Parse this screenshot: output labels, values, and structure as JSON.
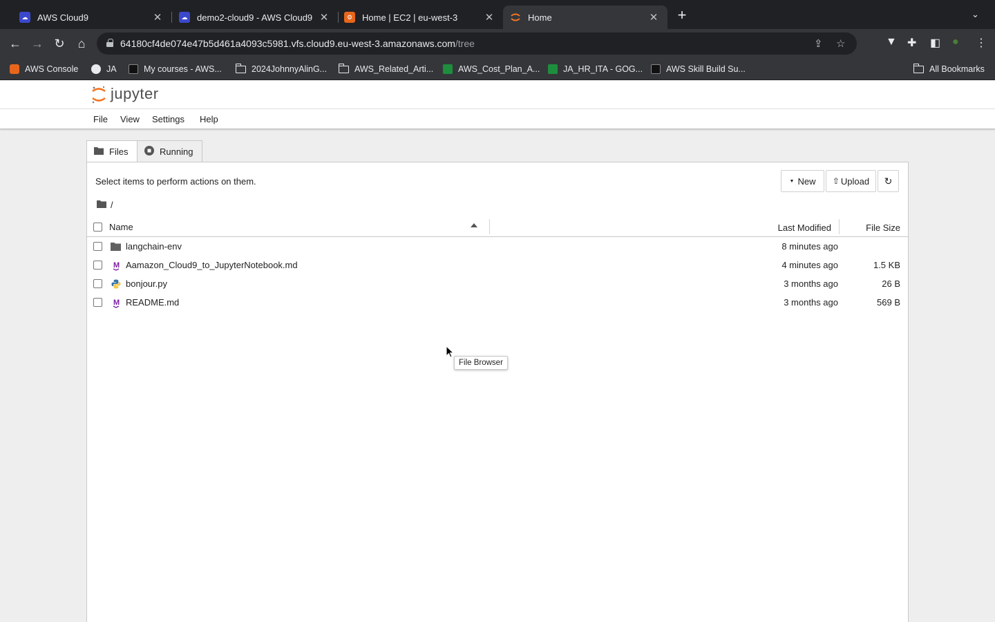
{
  "browser": {
    "tabs": [
      {
        "title": "AWS Cloud9",
        "favicon": "cloud9-icon",
        "active": false
      },
      {
        "title": "demo2-cloud9 - AWS Cloud9",
        "favicon": "cloud9-icon",
        "active": false
      },
      {
        "title": "Home | EC2 | eu-west-3",
        "favicon": "ec2-icon",
        "active": false
      },
      {
        "title": "Home",
        "favicon": "jupyter-icon",
        "active": true
      }
    ],
    "url_host": "64180cf4de074e47b5d461a4093c5981.vfs.cloud9.eu-west-3.amazonaws.com",
    "url_path": "/tree",
    "bookmarks": [
      {
        "label": "AWS Console",
        "icon": "aws-icon"
      },
      {
        "label": "JA",
        "icon": "globe-icon"
      },
      {
        "label": "My courses - AWS...",
        "icon": "aws-icon"
      },
      {
        "label": "2024JohnnyAlinG...",
        "icon": "folder-icon"
      },
      {
        "label": "AWS_Related_Arti...",
        "icon": "folder-icon"
      },
      {
        "label": "AWS_Cost_Plan_A...",
        "icon": "sheets-icon"
      },
      {
        "label": "JA_HR_ITA - GOG...",
        "icon": "sheets-icon"
      },
      {
        "label": "AWS Skill Build Su...",
        "icon": "aws-icon"
      }
    ],
    "all_bookmarks": "All Bookmarks"
  },
  "app": {
    "logo_text": "jupyter",
    "menu": [
      "File",
      "View",
      "Settings",
      "Help"
    ]
  },
  "tabs": {
    "files": "Files",
    "running": "Running"
  },
  "browser_panel": {
    "hint": "Select items to perform actions on them.",
    "new_label": "New",
    "upload_label": "Upload",
    "breadcrumb": "/",
    "columns": {
      "name": "Name",
      "modified": "Last Modified",
      "size": "File Size"
    },
    "files": [
      {
        "name": "langchain-env",
        "type": "folder",
        "modified": "8 minutes ago",
        "size": ""
      },
      {
        "name": "Aamazon_Cloud9_to_JupyterNotebook.md",
        "type": "markdown",
        "modified": "4 minutes ago",
        "size": "1.5 KB"
      },
      {
        "name": "bonjour.py",
        "type": "python",
        "modified": "3 months ago",
        "size": "26 B"
      },
      {
        "name": "README.md",
        "type": "markdown",
        "modified": "3 months ago",
        "size": "569 B"
      }
    ],
    "tooltip": "File Browser"
  },
  "colors": {
    "jupyter_orange": "#f37726",
    "markdown_purple": "#7b1fa2",
    "cloud9_blue": "#3b48cc",
    "ec2_orange": "#e8661c"
  }
}
